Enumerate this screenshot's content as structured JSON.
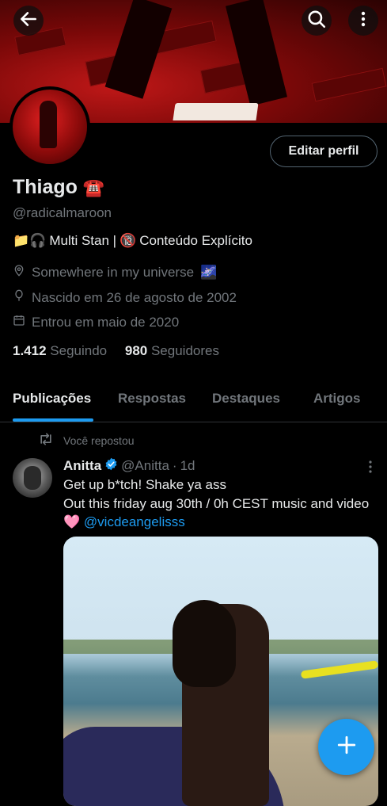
{
  "colors": {
    "accent": "#1d9bf0",
    "muted": "#71767b",
    "text": "#e7e9ea",
    "background": "#000000"
  },
  "header": {
    "back_icon": "arrow-left-icon",
    "search_icon": "search-icon",
    "more_icon": "more-vertical-icon"
  },
  "profile": {
    "edit_label": "Editar perfil",
    "name": "Thiago",
    "name_emoji": "☎️",
    "handle": "@radicalmaroon",
    "bio_emoji": "📁🎧",
    "bio_part1": "Multi Stan |",
    "bio_emoji2": "🔞",
    "bio_part2": "Conteúdo Explícito",
    "location": "Somewhere in my universe",
    "location_emoji": "🌌",
    "birthday": "Nascido em 26 de agosto de 2002",
    "joined": "Entrou em maio de 2020",
    "following_count": "1.412",
    "following_label": "Seguindo",
    "followers_count": "980",
    "followers_label": "Seguidores"
  },
  "tabs": [
    {
      "label": "Publicações",
      "active": true
    },
    {
      "label": "Respostas",
      "active": false
    },
    {
      "label": "Destaques",
      "active": false
    },
    {
      "label": "Artigos",
      "active": false
    }
  ],
  "tweet": {
    "repost_label": "Você repostou",
    "author": "Anitta",
    "verified_icon": "verified-badge-icon",
    "handle": "@Anitta",
    "separator": "·",
    "time": "1d",
    "line1": "Get up b*tch! Shake ya ass",
    "line2": "Out this friday aug 30th / 0h CEST music and video",
    "line3_emoji": "🩷",
    "line3_mention": "@vicdeangelisss"
  },
  "fab": {
    "icon": "plus-icon"
  }
}
